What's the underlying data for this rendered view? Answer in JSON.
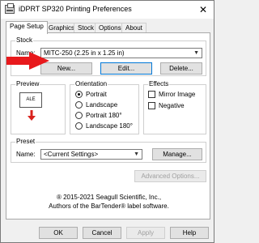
{
  "window": {
    "title": "iDPRT SP320 Printing Preferences",
    "close_glyph": "✕"
  },
  "tabs": [
    {
      "label": "Page Setup",
      "active": true
    },
    {
      "label": "Graphics"
    },
    {
      "label": "Stock"
    },
    {
      "label": "Options"
    },
    {
      "label": "About"
    }
  ],
  "stock": {
    "group_label": "Stock",
    "name_label": "Name:",
    "name_value": "MITC-250 (2.25 in x 1.25 in)",
    "new_button": "New...",
    "edit_button": "Edit...",
    "delete_button": "Delete..."
  },
  "preview": {
    "group_label": "Preview",
    "sample_text": "ALE"
  },
  "orientation": {
    "group_label": "Orientation",
    "options": [
      {
        "label": "Portrait",
        "checked": true
      },
      {
        "label": "Landscape",
        "checked": false
      },
      {
        "label": "Portrait 180°",
        "checked": false
      },
      {
        "label": "Landscape 180°",
        "checked": false
      }
    ]
  },
  "effects": {
    "group_label": "Effects",
    "options": [
      {
        "label": "Mirror Image",
        "checked": false
      },
      {
        "label": "Negative",
        "checked": false
      }
    ]
  },
  "preset": {
    "group_label": "Preset",
    "name_label": "Name:",
    "name_value": "<Current Settings>",
    "manage_button": "Manage..."
  },
  "advanced_button": "Advanced Options...",
  "copyright": {
    "line1": "® 2015-2021 Seagull Scientific, Inc.,",
    "line2": "Authors of the BarTender® label software."
  },
  "footer": {
    "ok": "OK",
    "cancel": "Cancel",
    "apply": "Apply",
    "help": "Help"
  },
  "colors": {
    "annotation_arrow": "#e8191c",
    "preview_arrow": "#d9221c",
    "focus_border": "#0078d7"
  },
  "icons": {
    "app": "printer-icon",
    "dropdown": "chevron-down-icon"
  }
}
